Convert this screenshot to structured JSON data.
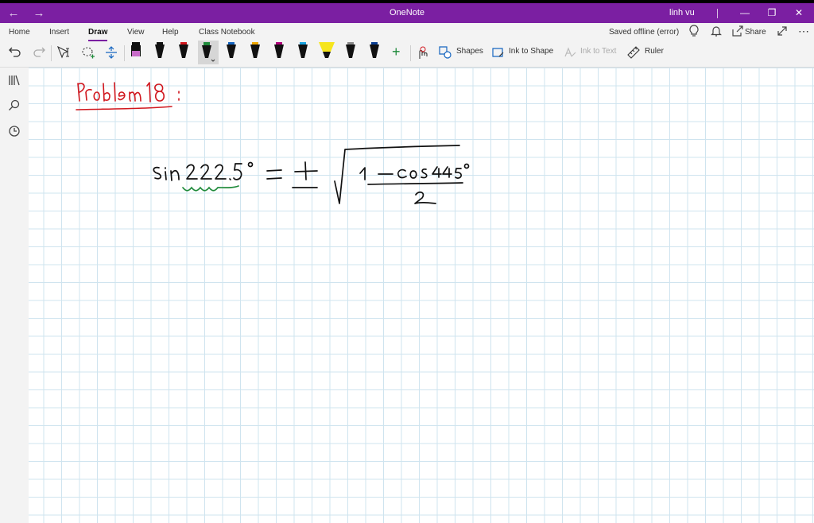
{
  "titlebar": {
    "app_title": "OneNote",
    "user_name": "linh vu"
  },
  "ribbon": {
    "tabs": [
      "Home",
      "Insert",
      "Draw",
      "View",
      "Help",
      "Class Notebook"
    ],
    "active_tab": "Draw",
    "status": "Saved offline (error)",
    "share_label": "Share",
    "tools": {
      "shapes_label": "Shapes",
      "ink_to_shape_label": "Ink to Shape",
      "ink_to_text_label": "Ink to Text",
      "ruler_label": "Ruler"
    },
    "pen_colors": [
      "#c86cc9",
      "#111111",
      "#d0161d",
      "#1e8a3a",
      "#1565c0",
      "#f0a800",
      "#b0007a",
      "#1aa3e0",
      "#f6e51d",
      "#666666",
      "#0a3d91"
    ]
  },
  "colors": {
    "accent": "#7b1fa2",
    "grid": "#cfe4ef",
    "ink_black": "#111111",
    "ink_red": "#d0161d",
    "ink_green": "#1e8a3a"
  }
}
